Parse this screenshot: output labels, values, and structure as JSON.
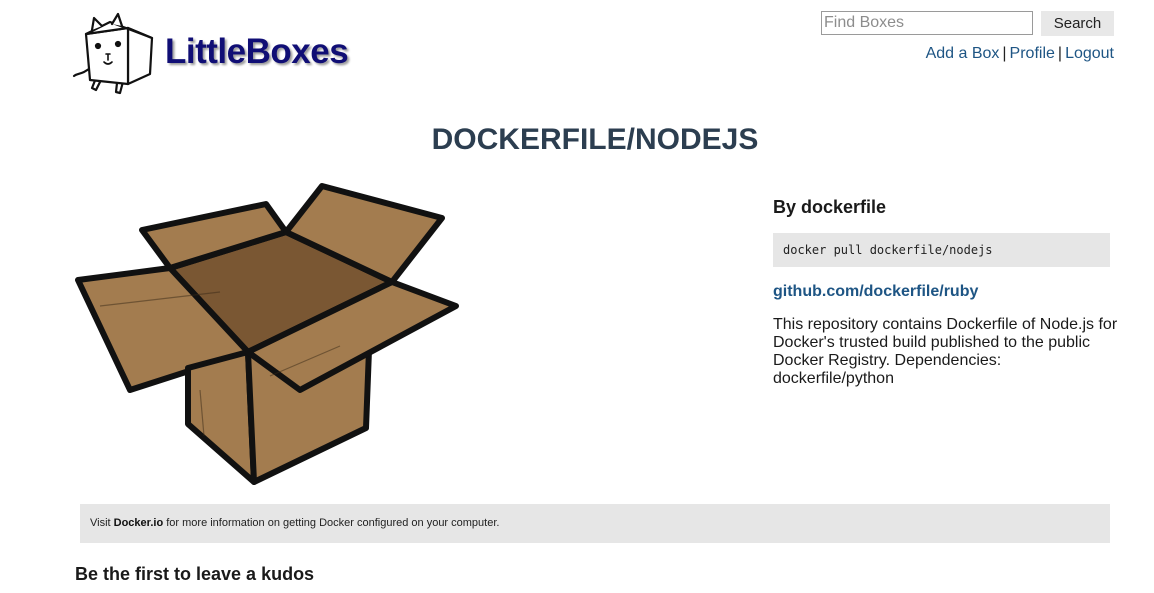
{
  "header": {
    "logo_text": "LittleBoxes",
    "search": {
      "placeholder": "Find Boxes",
      "value": "",
      "button_label": "Search"
    },
    "nav": {
      "add_box": "Add a Box",
      "profile": "Profile",
      "logout": "Logout",
      "separator": "|"
    }
  },
  "main": {
    "title": "DOCKERFILE/NODEJS",
    "author": "By dockerfile",
    "pull_command": "docker pull dockerfile/nodejs",
    "repo_link": "github.com/dockerfile/ruby",
    "description": "This repository contains Dockerfile of Node.js for Docker's trusted build published to the public Docker Registry. Dependencies: dockerfile/python",
    "image_icon": "open-cardboard-box"
  },
  "info_bar": {
    "prefix": "Visit ",
    "link": "Docker.io",
    "suffix": " for more information on getting Docker configured on your computer."
  },
  "kudos": {
    "heading": "Be the first to leave a kudos"
  },
  "colors": {
    "logo": "#100e75",
    "link": "#1e5584",
    "title": "#2c3e50",
    "panel_bg": "#e6e6e6",
    "box_brown": "#a37c4f",
    "box_inside": "#7a5733"
  }
}
